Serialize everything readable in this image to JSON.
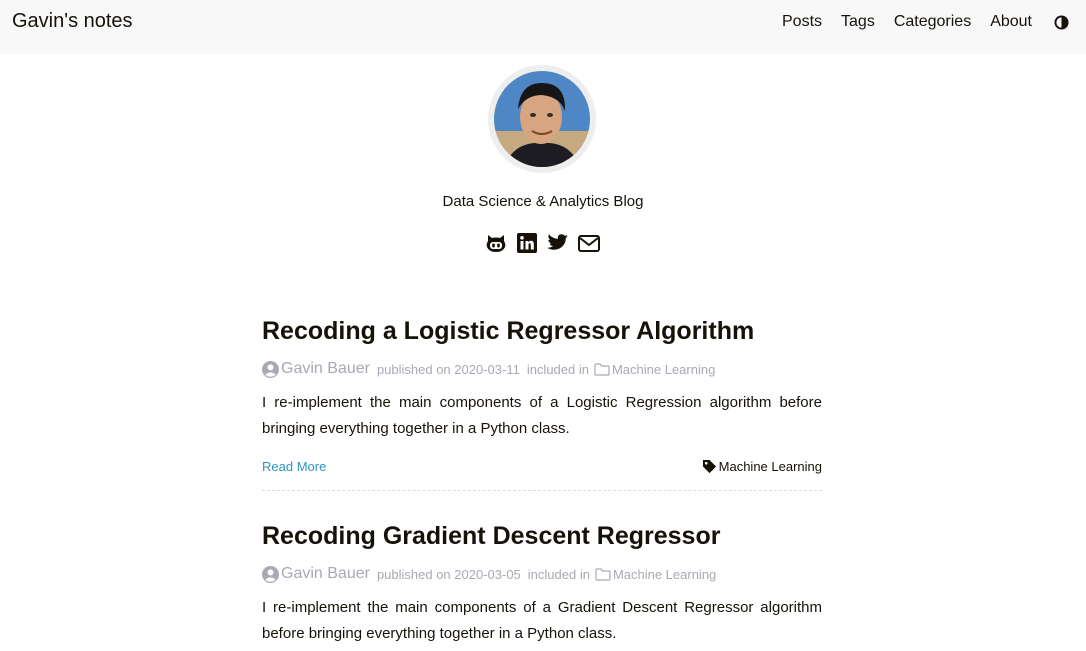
{
  "nav": {
    "brand": "Gavin's notes",
    "items": [
      {
        "label": "Posts"
      },
      {
        "label": "Tags"
      },
      {
        "label": "Categories"
      },
      {
        "label": "About"
      }
    ]
  },
  "profile": {
    "subtitle": "Data Science & Analytics Blog",
    "social": [
      "github-icon",
      "linkedin-icon",
      "twitter-icon",
      "email-icon"
    ]
  },
  "posts": [
    {
      "title": "Recoding a Logistic Regressor Algorithm",
      "author": "Gavin Bauer",
      "published": "published on 2020-03-11",
      "included": "included in",
      "category": "Machine Learning",
      "summary": "I re-implement the main components of a Logistic Regression algorithm before bringing everything together in a Python class.",
      "read_more": "Read More",
      "tag": "Machine Learning"
    },
    {
      "title": "Recoding Gradient Descent Regressor",
      "author": "Gavin Bauer",
      "published": "published on 2020-03-05",
      "included": "included in",
      "category": "Machine Learning",
      "summary": "I re-implement the main components of a Gradient Descent Regressor algorithm before bringing everything together in a Python class."
    }
  ],
  "colors": {
    "text": "#161209",
    "meta": "#a9a9b3",
    "link": "#2d96bd",
    "navbar_bg": "#f8f8f8"
  }
}
